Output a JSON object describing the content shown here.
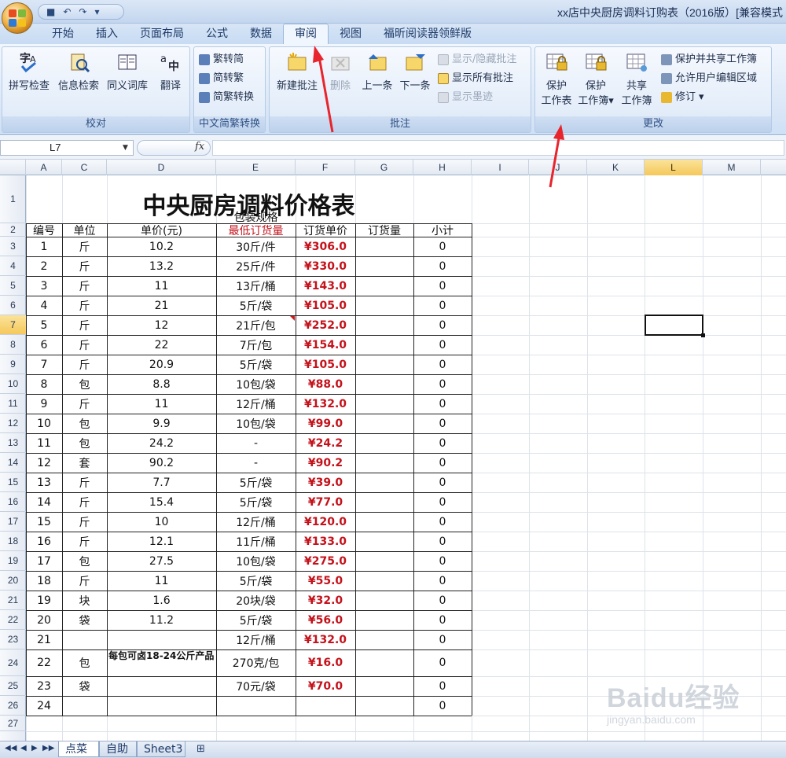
{
  "title_bar": {
    "qat_icons": [
      "save-icon",
      "undo-icon",
      "redo-icon",
      "customize-icon"
    ],
    "title": "xx店中央厨房调料订购表（2016版）[兼容模式"
  },
  "tabs": [
    "开始",
    "插入",
    "页面布局",
    "公式",
    "数据",
    "审阅",
    "视图",
    "福昕阅读器领鲜版"
  ],
  "active_tab": "审阅",
  "ribbon": {
    "proofing": {
      "label": "校对",
      "buttons": [
        "拼写检查",
        "信息检索",
        "同义词库",
        "翻译"
      ]
    },
    "chinese": {
      "label": "中文简繁转换",
      "buttons": [
        "繁转简",
        "简转繁",
        "简繁转换"
      ]
    },
    "comments": {
      "label": "批注",
      "new": "新建批注",
      "delete": "删除",
      "prev": "上一条",
      "next": "下一条",
      "show_hide": "显示/隐藏批注",
      "show_all": "显示所有批注",
      "show_ink": "显示墨迹"
    },
    "changes": {
      "label": "更改",
      "protect_sheet": [
        "保护",
        "工作表"
      ],
      "protect_workbook": [
        "保护",
        "工作簿"
      ],
      "share_workbook": [
        "共享",
        "工作簿"
      ],
      "protect_share": "保护并共享工作簿",
      "allow_edit": "允许用户编辑区域",
      "track": "修订"
    }
  },
  "formula_bar": {
    "name_box": "L7",
    "fx": "fx",
    "formula": ""
  },
  "columns": [
    "A",
    "C",
    "D",
    "E",
    "F",
    "G",
    "H",
    "I",
    "J",
    "K",
    "L",
    "M"
  ],
  "selected_column": "L",
  "selected_row": "7",
  "sheet": {
    "title": "中央厨房调料价格表",
    "headers": {
      "a": "编号",
      "c": "单位",
      "d": "单价(元)",
      "e_top": "包装规格",
      "e_bottom": "最低订货量",
      "f": "订货单价",
      "g": "订货量",
      "h": "小计"
    },
    "rows": [
      {
        "r": "3",
        "a": "1",
        "c": "斤",
        "d": "10.2",
        "e": "30斤/件",
        "f": "¥306.0",
        "h": "0"
      },
      {
        "r": "4",
        "a": "2",
        "c": "斤",
        "d": "13.2",
        "e": "25斤/件",
        "f": "¥330.0",
        "h": "0"
      },
      {
        "r": "5",
        "a": "3",
        "c": "斤",
        "d": "11",
        "e": "13斤/桶",
        "f": "¥143.0",
        "h": "0"
      },
      {
        "r": "6",
        "a": "4",
        "c": "斤",
        "d": "21",
        "e": "5斤/袋",
        "f": "¥105.0",
        "h": "0"
      },
      {
        "r": "7",
        "a": "5",
        "c": "斤",
        "d": "12",
        "e": "21斤/包",
        "f": "¥252.0",
        "h": "0"
      },
      {
        "r": "8",
        "a": "6",
        "c": "斤",
        "d": "22",
        "e": "7斤/包",
        "f": "¥154.0",
        "h": "0"
      },
      {
        "r": "9",
        "a": "7",
        "c": "斤",
        "d": "20.9",
        "e": "5斤/袋",
        "f": "¥105.0",
        "h": "0"
      },
      {
        "r": "10",
        "a": "8",
        "c": "包",
        "d": "8.8",
        "e": "10包/袋",
        "f": "¥88.0",
        "h": "0"
      },
      {
        "r": "11",
        "a": "9",
        "c": "斤",
        "d": "11",
        "e": "12斤/桶",
        "f": "¥132.0",
        "h": "0"
      },
      {
        "r": "12",
        "a": "10",
        "c": "包",
        "d": "9.9",
        "e": "10包/袋",
        "f": "¥99.0",
        "h": "0"
      },
      {
        "r": "13",
        "a": "11",
        "c": "包",
        "d": "24.2",
        "e": "-",
        "f": "¥24.2",
        "h": "0"
      },
      {
        "r": "14",
        "a": "12",
        "c": "套",
        "d": "90.2",
        "e": "-",
        "f": "¥90.2",
        "h": "0"
      },
      {
        "r": "15",
        "a": "13",
        "c": "斤",
        "d": "7.7",
        "e": "5斤/袋",
        "f": "¥39.0",
        "h": "0"
      },
      {
        "r": "16",
        "a": "14",
        "c": "斤",
        "d": "15.4",
        "e": "5斤/袋",
        "f": "¥77.0",
        "h": "0"
      },
      {
        "r": "17",
        "a": "15",
        "c": "斤",
        "d": "10",
        "e": "12斤/桶",
        "f": "¥120.0",
        "h": "0"
      },
      {
        "r": "18",
        "a": "16",
        "c": "斤",
        "d": "12.1",
        "e": "11斤/桶",
        "f": "¥133.0",
        "h": "0"
      },
      {
        "r": "19",
        "a": "17",
        "c": "包",
        "d": "27.5",
        "e": "10包/袋",
        "f": "¥275.0",
        "h": "0"
      },
      {
        "r": "20",
        "a": "18",
        "c": "斤",
        "d": "11",
        "e": "5斤/袋",
        "f": "¥55.0",
        "h": "0"
      },
      {
        "r": "21",
        "a": "19",
        "c": "块",
        "d": "1.6",
        "e": "20块/袋",
        "f": "¥32.0",
        "h": "0"
      },
      {
        "r": "22",
        "a": "20",
        "c": "袋",
        "d": "11.2",
        "e": "5斤/袋",
        "f": "¥56.0",
        "h": "0"
      },
      {
        "r": "23",
        "a": "21",
        "c": "",
        "d": "",
        "e": "12斤/桶",
        "f": "¥132.0",
        "h": "0"
      },
      {
        "r": "24",
        "a": "22",
        "c": "包",
        "d": "每包可卤18-24公斤产品",
        "e": "270克/包",
        "f": "¥16.0",
        "h": "0"
      },
      {
        "r": "25",
        "a": "23",
        "c": "袋",
        "d": "",
        "e": "70元/袋",
        "f": "¥70.0",
        "h": "0"
      },
      {
        "r": "26",
        "a": "24",
        "c": "",
        "d": "",
        "e": "",
        "f": "",
        "h": "0"
      },
      {
        "r": "27",
        "a": "",
        "c": "",
        "d": "",
        "e": "",
        "f": "",
        "h": ""
      }
    ]
  },
  "sheet_tabs": [
    "点菜",
    "自助",
    "Sheet3"
  ],
  "active_sheet": "点菜",
  "watermark": "Baidu经验",
  "watermark_url": "jingyan.baidu.com"
}
